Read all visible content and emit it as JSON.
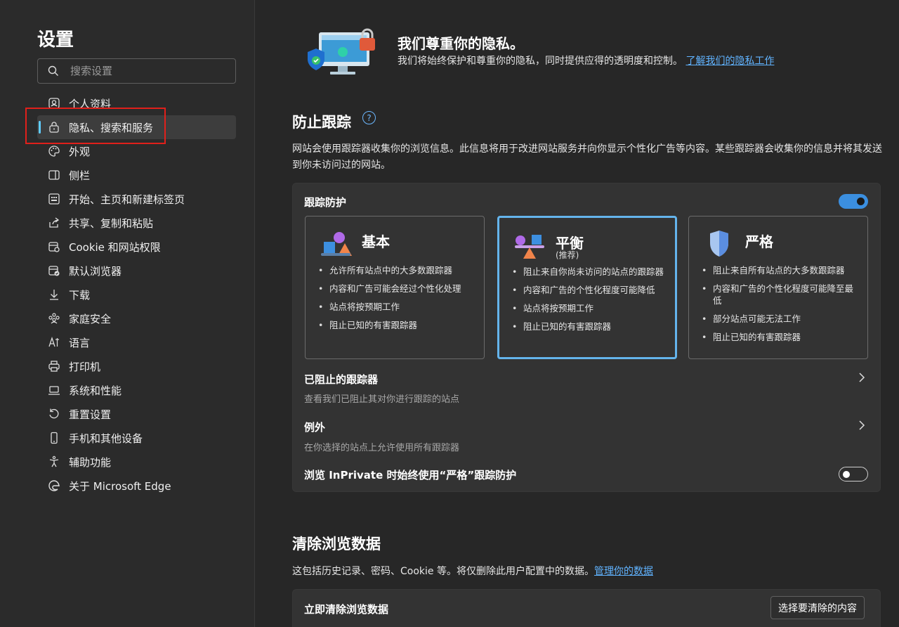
{
  "sidebar": {
    "title": "设置",
    "search_placeholder": "搜索设置",
    "items": [
      {
        "label": "个人资料"
      },
      {
        "label": "隐私、搜索和服务"
      },
      {
        "label": "外观"
      },
      {
        "label": "侧栏"
      },
      {
        "label": "开始、主页和新建标签页"
      },
      {
        "label": "共享、复制和粘贴"
      },
      {
        "label": "Cookie 和网站权限"
      },
      {
        "label": "默认浏览器"
      },
      {
        "label": "下载"
      },
      {
        "label": "家庭安全"
      },
      {
        "label": "语言"
      },
      {
        "label": "打印机"
      },
      {
        "label": "系统和性能"
      },
      {
        "label": "重置设置"
      },
      {
        "label": "手机和其他设备"
      },
      {
        "label": "辅助功能"
      },
      {
        "label": "关于 Microsoft Edge"
      }
    ],
    "active_item": "隐私、搜索和服务"
  },
  "privacy": {
    "title": "我们尊重你的隐私。",
    "desc": "我们将始终保护和尊重你的隐私，同时提供应得的透明度和控制。",
    "link": "了解我们的隐私工作"
  },
  "tracking": {
    "title": "防止跟踪",
    "help": "?",
    "desc": "网站会使用跟踪器收集你的浏览信息。此信息将用于改进网站服务并向你显示个性化广告等内容。某些跟踪器会收集你的信息并将其发送到你未访问过的网站。",
    "protection_label": "跟踪防护",
    "protection_on": true,
    "levels": [
      {
        "name": "基本",
        "rec": "",
        "bullets": [
          "允许所有站点中的大多数跟踪器",
          "内容和广告可能会经过个性化处理",
          "站点将按预期工作",
          "阻止已知的有害跟踪器"
        ]
      },
      {
        "name": "平衡",
        "rec": "(推荐)",
        "bullets": [
          "阻止来自你尚未访问的站点的跟踪器",
          "内容和广告的个性化程度可能降低",
          "站点将按预期工作",
          "阻止已知的有害跟踪器"
        ]
      },
      {
        "name": "严格",
        "rec": "",
        "bullets": [
          "阻止来自所有站点的大多数跟踪器",
          "内容和广告的个性化程度可能降至最低",
          "部分站点可能无法工作",
          "阻止已知的有害跟踪器"
        ]
      }
    ],
    "selected_level": "平衡",
    "blocked_title": "已阻止的跟踪器",
    "blocked_sub": "查看我们已阻止其对你进行跟踪的站点",
    "exceptions_title": "例外",
    "exceptions_sub": "在你选择的站点上允许使用所有跟踪器",
    "inprivate_label": "浏览 InPrivate 时始终使用“严格”跟踪防护",
    "inprivate_on": false
  },
  "clear": {
    "title": "清除浏览数据",
    "desc": "这包括历史记录、密码、Cookie 等。将仅删除此用户配置中的数据。",
    "link": "管理你的数据",
    "now_label": "立即清除浏览数据",
    "button": "选择要清除的内容"
  },
  "colors": {
    "accent": "#60cdff",
    "link": "#60b3ff",
    "toggle_on": "#3b8fe0",
    "selected_border": "#64b4ec",
    "highlight_box": "#e0201b"
  }
}
